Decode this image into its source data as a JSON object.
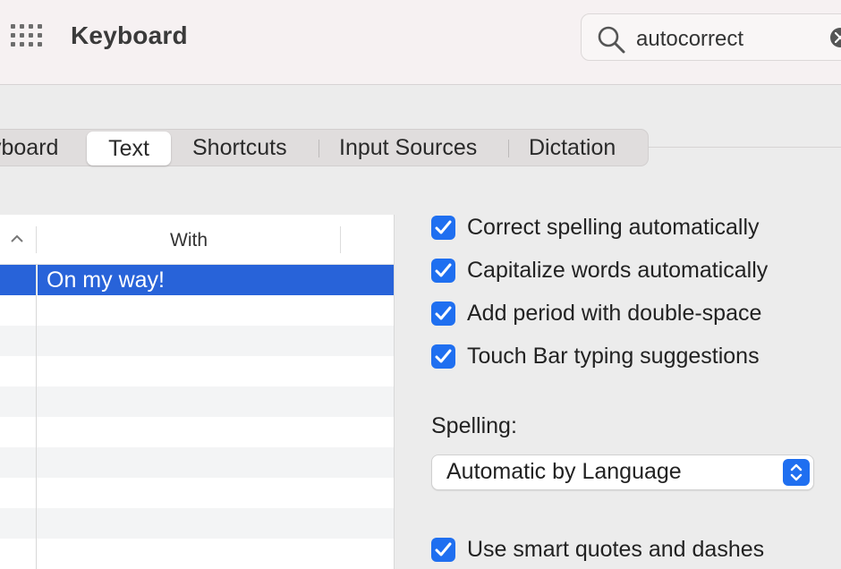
{
  "window": {
    "title": "Keyboard"
  },
  "search": {
    "value": "autocorrect"
  },
  "tabs": [
    {
      "label": "Keyboard",
      "shown": "yboard",
      "active": false
    },
    {
      "label": "Text",
      "active": true
    },
    {
      "label": "Shortcuts",
      "active": false
    },
    {
      "label": "Input Sources",
      "active": false
    },
    {
      "label": "Dictation",
      "active": false
    }
  ],
  "table": {
    "columns": {
      "with": "With"
    },
    "rows": [
      {
        "with": "On my way!",
        "selected": true
      }
    ]
  },
  "options": {
    "correct_spelling": {
      "label": "Correct spelling automatically",
      "checked": true
    },
    "capitalize_words": {
      "label": "Capitalize words automatically",
      "checked": true
    },
    "add_period": {
      "label": "Add period with double-space",
      "checked": true
    },
    "touch_bar": {
      "label": "Touch Bar typing suggestions",
      "checked": true
    },
    "smart_quotes": {
      "label": "Use smart quotes and dashes",
      "checked": true
    }
  },
  "spelling": {
    "label": "Spelling:",
    "selected": "Automatic by Language"
  },
  "colors": {
    "accent": "#1f6ff0",
    "selection": "#2863d9"
  }
}
